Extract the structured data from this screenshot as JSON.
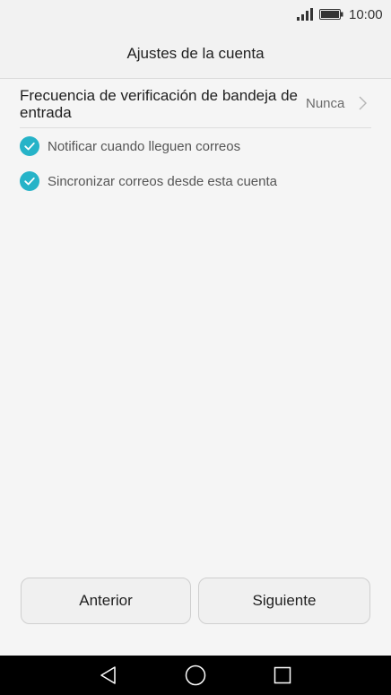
{
  "status_bar": {
    "time": "10:00",
    "signal_icon": "signal-icon",
    "battery_icon": "battery-icon"
  },
  "header": {
    "title": "Ajustes de la cuenta"
  },
  "settings": {
    "frequency": {
      "label": "Frecuencia de verificación de bandeja de entrada",
      "value": "Nunca",
      "icon": "chevron-right-icon"
    },
    "options": [
      {
        "label": "Notificar cuando lleguen correos",
        "checked": true
      },
      {
        "label": "Sincronizar correos desde esta cuenta",
        "checked": true
      }
    ]
  },
  "footer": {
    "previous_label": "Anterior",
    "next_label": "Siguiente"
  },
  "nav_bar": {
    "back_icon": "nav-back-icon",
    "home_icon": "nav-home-icon",
    "recent_icon": "nav-recent-icon"
  },
  "colors": {
    "accent": "#26b3c8",
    "background": "#f5f5f5",
    "nav_bar": "#000000"
  }
}
